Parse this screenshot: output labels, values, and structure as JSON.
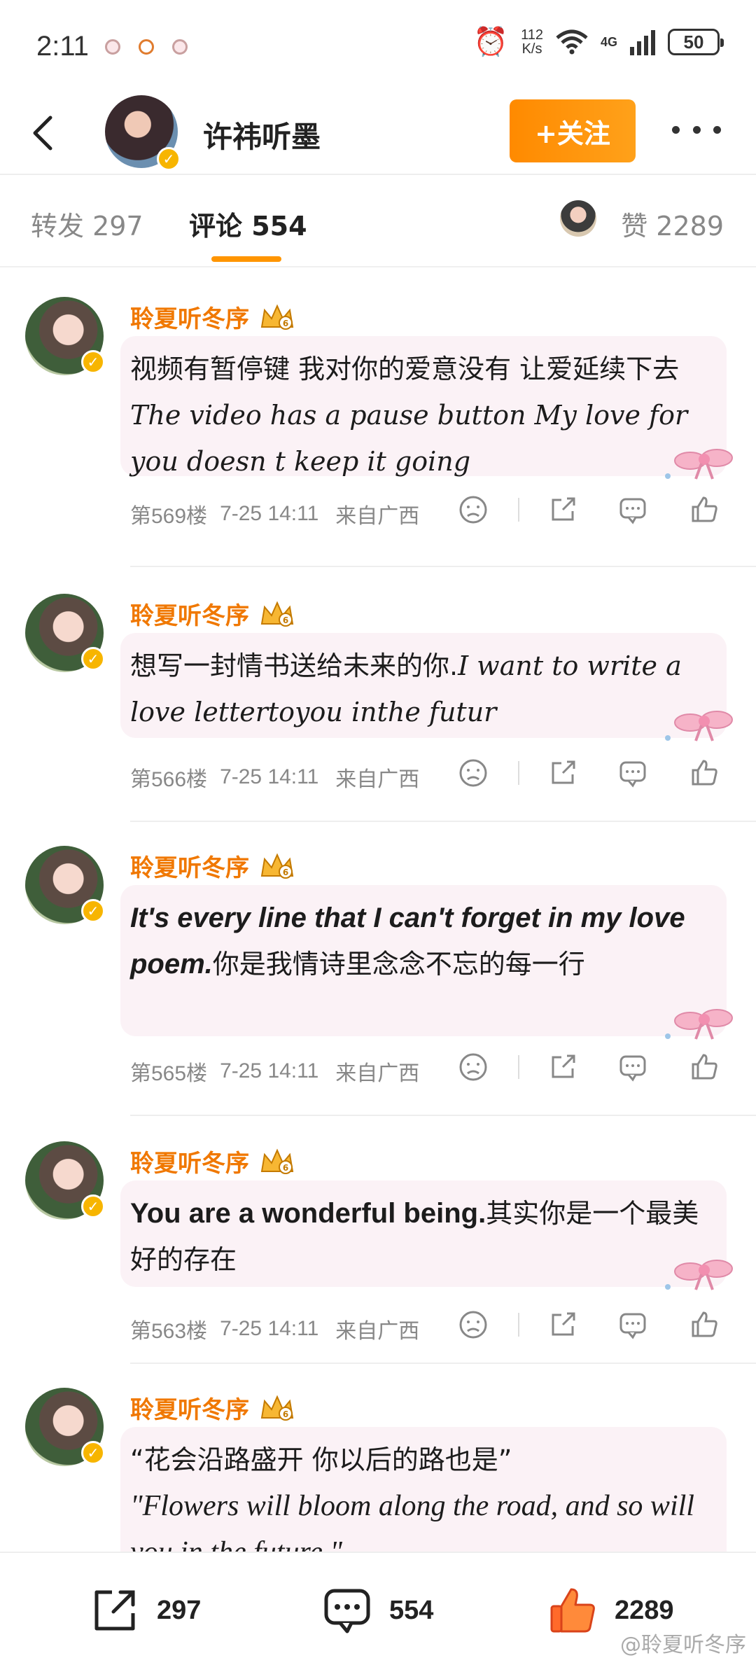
{
  "status_bar": {
    "time": "2:11",
    "net_speed_value": "112",
    "net_speed_unit": "K/s",
    "network": "4G",
    "battery": "50"
  },
  "header": {
    "user_name": "许祎听墨",
    "follow_label": "+关注"
  },
  "tabs": {
    "repost": "转发 297",
    "comments": "评论 554",
    "likes": "赞 2289"
  },
  "comments": [
    {
      "author": "聆夏听冬序",
      "text_cn": "视频有暂停键 我对你的爱意没有 让爱延续下去 ",
      "text_en": "The video has a pause button  My love for you doesn t keep it going",
      "floor": "第569楼",
      "time": "7-25 14:11",
      "location": "来自广西"
    },
    {
      "author": "聆夏听冬序",
      "text_cn": "想写⼀封情书送给未来的你.",
      "text_en": "I want to write a love lettertoyou inthe futur",
      "floor": "第566楼",
      "time": "7-25 14:11",
      "location": "来自广西"
    },
    {
      "author": "聆夏听冬序",
      "text_en": "It's every line that I can't forget in my love poem.",
      "text_cn": "你是我情诗里念念不忘的每⼀行",
      "floor": "第565楼",
      "time": "7-25 14:11",
      "location": "来自广西"
    },
    {
      "author": "聆夏听冬序",
      "text_en": "You are a wonderful being.",
      "text_cn": "其实你是⼀个最美好的存在",
      "floor": "第563楼",
      "time": "7-25 14:11",
      "location": "来自广西"
    },
    {
      "author": "聆夏听冬序",
      "text_cn": "“花会沿路盛开 你以后的路也是”",
      "text_en": "\"Flowers will bloom along the road, and so will you in the future.\""
    }
  ],
  "bottom_bar": {
    "repost_count": "297",
    "comment_count": "554",
    "like_count": "2289",
    "watermark": "@聆夏听冬序"
  },
  "colors": {
    "accent": "#ff9500",
    "author_name": "#f07800",
    "bubble_bg": "#fbf2f6",
    "like_active": "#ff6a2a"
  }
}
